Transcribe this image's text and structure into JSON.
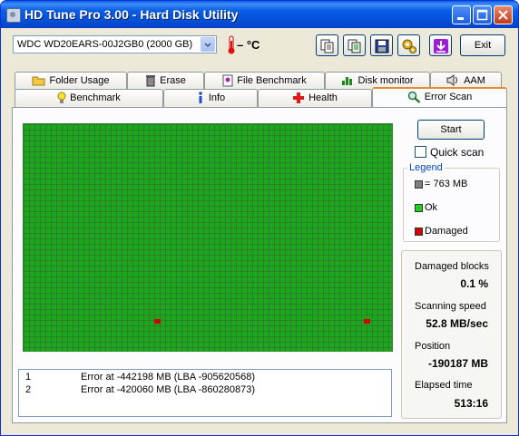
{
  "window": {
    "title": "HD Tune Pro 3.00 - Hard Disk Utility"
  },
  "toolbar": {
    "drive": "WDC WD20EARS-00J2GB0 (2000 GB)",
    "temperature": "– °C",
    "exit_label": "Exit",
    "icons": [
      "copy-info-icon",
      "copy-all-icon",
      "save-icon",
      "options-icon",
      "download-icon"
    ]
  },
  "tabs": {
    "row1": [
      {
        "label": "Folder Usage",
        "icon": "folder-icon"
      },
      {
        "label": "Erase",
        "icon": "trash-icon"
      },
      {
        "label": "File Benchmark",
        "icon": "file-icon"
      },
      {
        "label": "Disk monitor",
        "icon": "monitor-chart-icon"
      },
      {
        "label": "AAM",
        "icon": "speaker-icon"
      }
    ],
    "row2": [
      {
        "label": "Benchmark",
        "icon": "bulb-icon"
      },
      {
        "label": "Info",
        "icon": "info-icon"
      },
      {
        "label": "Health",
        "icon": "health-cross-icon"
      },
      {
        "label": "Error Scan",
        "icon": "magnifier-icon"
      }
    ],
    "active": "Error Scan"
  },
  "scan": {
    "grid_status": "ok",
    "damaged_blocks_count": 2,
    "colors": {
      "ok": "#1fd01f",
      "damaged": "#d40000",
      "block": "#808080"
    }
  },
  "log": [
    {
      "num": "1",
      "message": "Error at -442198 MB (LBA -905620568)"
    },
    {
      "num": "2",
      "message": "Error at -420060 MB (LBA -860280873)"
    }
  ],
  "controls": {
    "start_label": "Start",
    "quick_scan_label": "Quick scan",
    "quick_scan_checked": false
  },
  "legend": {
    "title": "Legend",
    "block_size": "= 763 MB",
    "ok": "Ok",
    "damaged": "Damaged"
  },
  "stats": {
    "damaged_blocks_label": "Damaged blocks",
    "damaged_blocks_value": "0.1 %",
    "scanning_speed_label": "Scanning speed",
    "scanning_speed_value": "52.8 MB/sec",
    "position_label": "Position",
    "position_value": "-190187 MB",
    "elapsed_label": "Elapsed time",
    "elapsed_value": "513:16"
  }
}
